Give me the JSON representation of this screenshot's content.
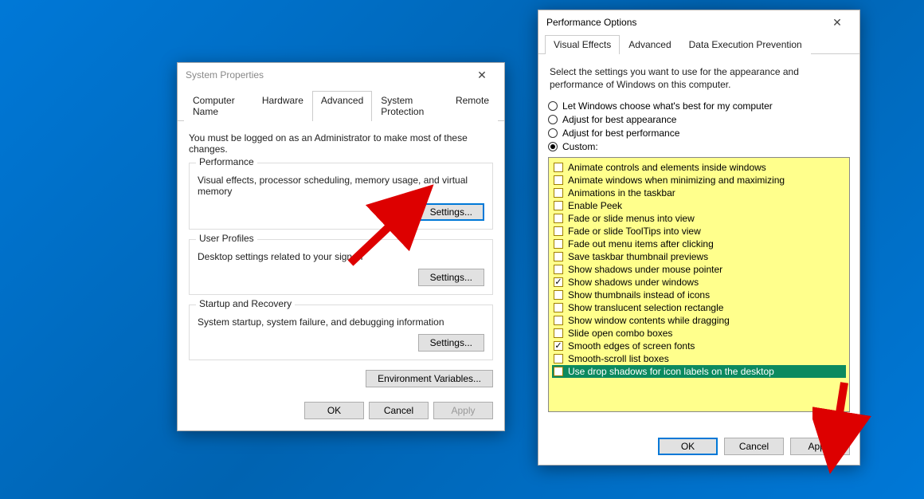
{
  "sp": {
    "title": "System Properties",
    "tabs": [
      "Computer Name",
      "Hardware",
      "Advanced",
      "System Protection",
      "Remote"
    ],
    "active_tab": 2,
    "instruction": "You must be logged on as an Administrator to make most of these changes.",
    "groups": {
      "performance": {
        "legend": "Performance",
        "desc": "Visual effects, processor scheduling, memory usage, and virtual memory",
        "button": "Settings..."
      },
      "user_profiles": {
        "legend": "User Profiles",
        "desc": "Desktop settings related to your sign-in",
        "button": "Settings..."
      },
      "startup": {
        "legend": "Startup and Recovery",
        "desc": "System startup, system failure, and debugging information",
        "button": "Settings..."
      }
    },
    "env_button": "Environment Variables...",
    "ok": "OK",
    "cancel": "Cancel",
    "apply": "Apply"
  },
  "po": {
    "title": "Performance Options",
    "tabs": [
      "Visual Effects",
      "Advanced",
      "Data Execution Prevention"
    ],
    "active_tab": 0,
    "instruction": "Select the settings you want to use for the appearance and performance of Windows on this computer.",
    "radios": [
      {
        "label": "Let Windows choose what's best for my computer",
        "selected": false
      },
      {
        "label": "Adjust for best appearance",
        "selected": false
      },
      {
        "label": "Adjust for best performance",
        "selected": false
      },
      {
        "label": "Custom:",
        "selected": true
      }
    ],
    "options": [
      {
        "label": "Animate controls and elements inside windows",
        "checked": false,
        "selected": false
      },
      {
        "label": "Animate windows when minimizing and maximizing",
        "checked": false,
        "selected": false
      },
      {
        "label": "Animations in the taskbar",
        "checked": false,
        "selected": false
      },
      {
        "label": "Enable Peek",
        "checked": false,
        "selected": false
      },
      {
        "label": "Fade or slide menus into view",
        "checked": false,
        "selected": false
      },
      {
        "label": "Fade or slide ToolTips into view",
        "checked": false,
        "selected": false
      },
      {
        "label": "Fade out menu items after clicking",
        "checked": false,
        "selected": false
      },
      {
        "label": "Save taskbar thumbnail previews",
        "checked": false,
        "selected": false
      },
      {
        "label": "Show shadows under mouse pointer",
        "checked": false,
        "selected": false
      },
      {
        "label": "Show shadows under windows",
        "checked": true,
        "selected": false
      },
      {
        "label": "Show thumbnails instead of icons",
        "checked": false,
        "selected": false
      },
      {
        "label": "Show translucent selection rectangle",
        "checked": false,
        "selected": false
      },
      {
        "label": "Show window contents while dragging",
        "checked": false,
        "selected": false
      },
      {
        "label": "Slide open combo boxes",
        "checked": false,
        "selected": false
      },
      {
        "label": "Smooth edges of screen fonts",
        "checked": true,
        "selected": false
      },
      {
        "label": "Smooth-scroll list boxes",
        "checked": false,
        "selected": false
      },
      {
        "label": "Use drop shadows for icon labels on the desktop",
        "checked": false,
        "selected": true
      }
    ],
    "ok": "OK",
    "cancel": "Cancel",
    "apply": "Apply"
  }
}
